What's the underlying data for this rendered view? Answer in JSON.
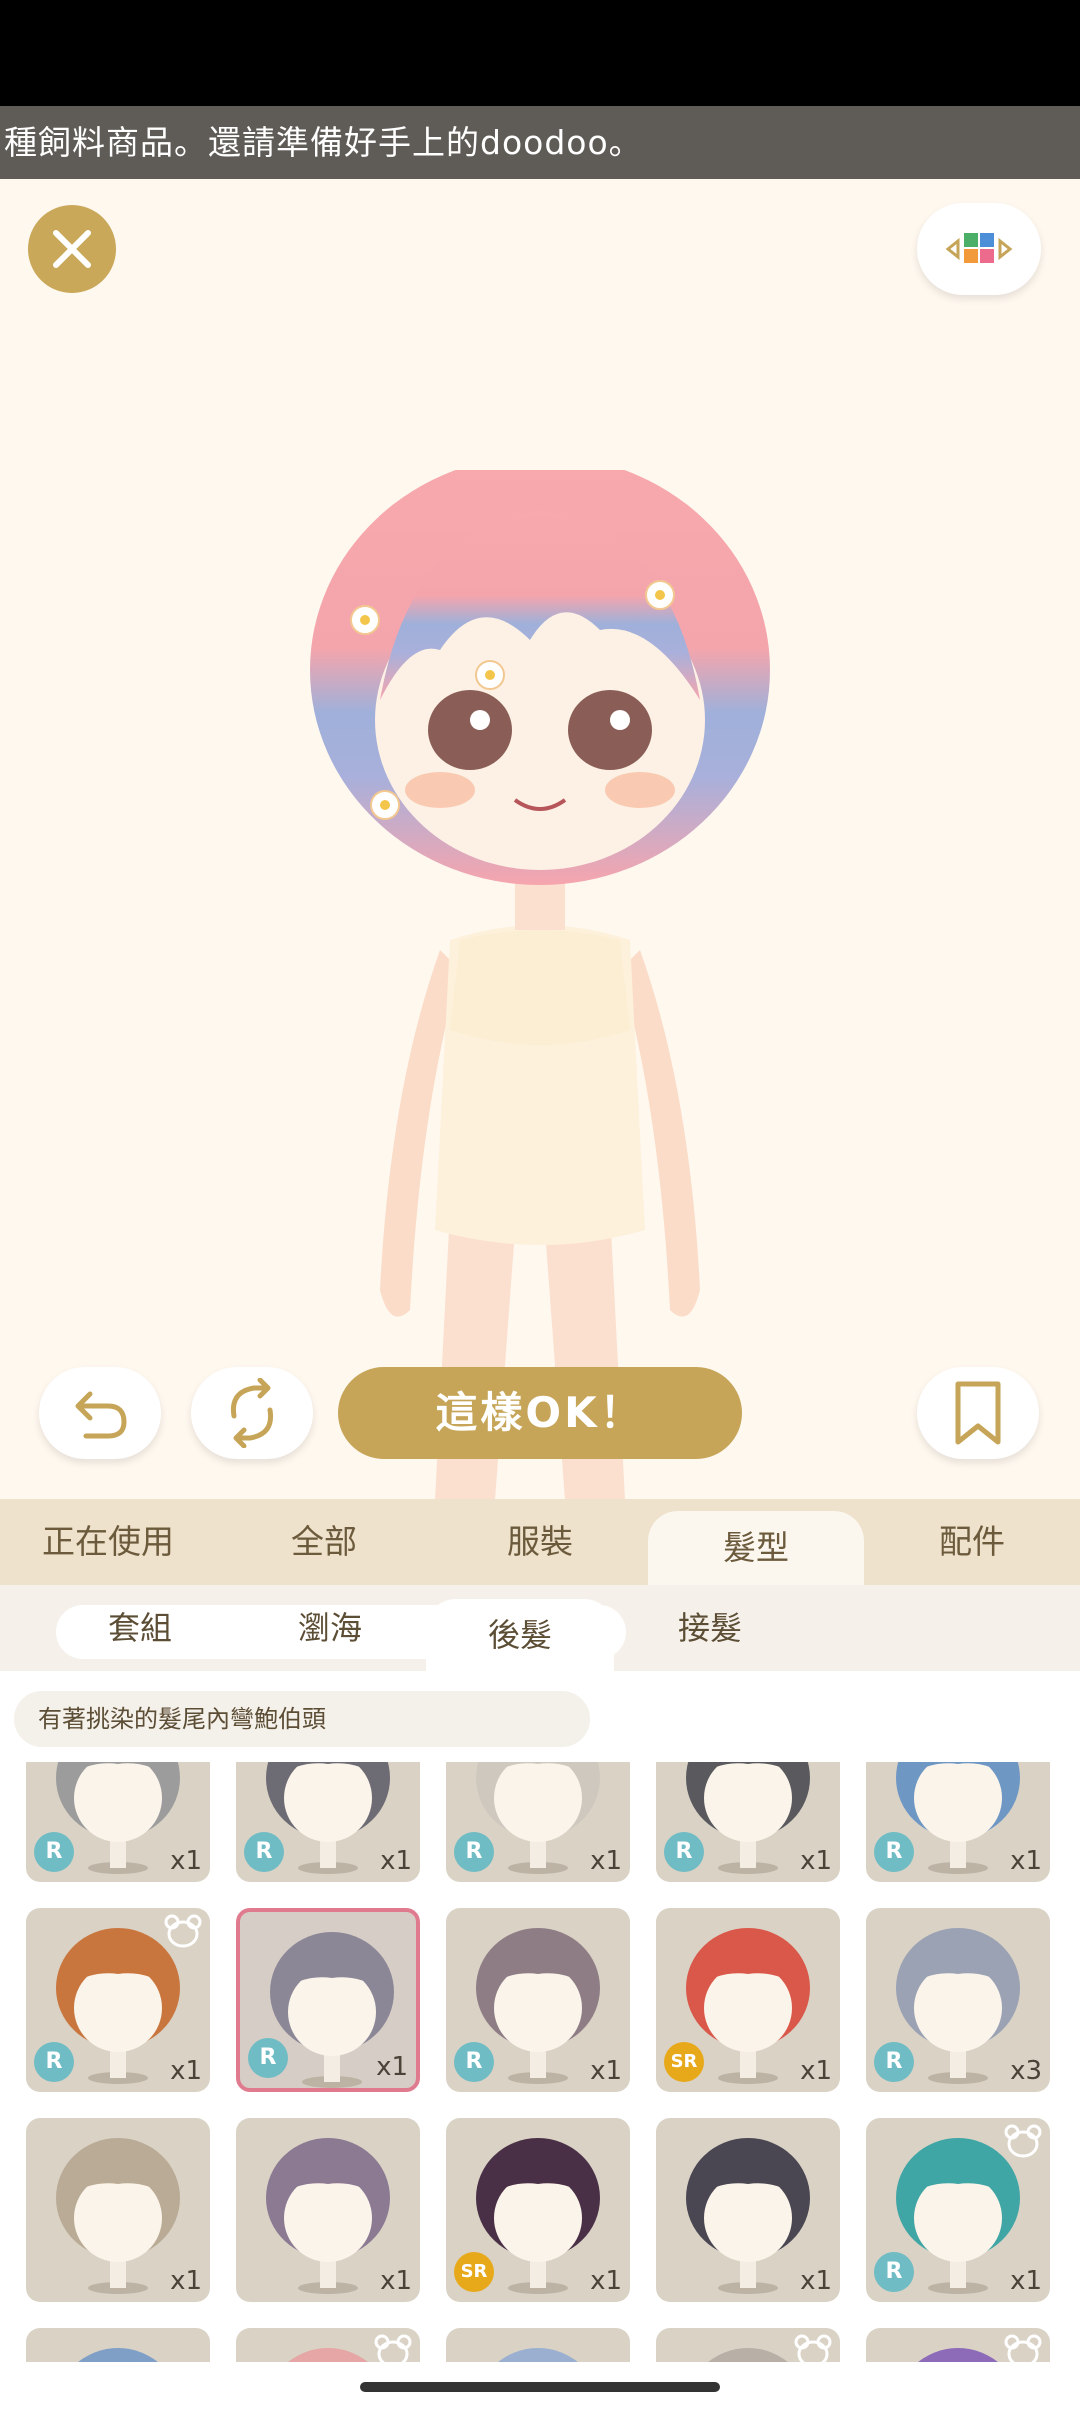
{
  "marquee": {
    "text": "種飼料商品。還請準備好手上的doodoo。"
  },
  "actions": {
    "ok_label": "這樣OK！"
  },
  "tabs": [
    {
      "label": "正在使用"
    },
    {
      "label": "全部"
    },
    {
      "label": "服裝"
    },
    {
      "label": "髮型",
      "active": true
    },
    {
      "label": "配件"
    }
  ],
  "subtabs": [
    {
      "label": "套組"
    },
    {
      "label": "瀏海"
    },
    {
      "label": "後髮",
      "active": true
    },
    {
      "label": "接髮"
    }
  ],
  "item_description": "有著挑染的髮尾內彎鮑伯頭",
  "items": [
    {
      "rarity": "R",
      "count": "x1",
      "hair_color": "#9c9c9c"
    },
    {
      "rarity": "R",
      "count": "x1",
      "hair_color": "#6d6b73"
    },
    {
      "rarity": "R",
      "count": "x1",
      "hair_color": "#cfc8bf"
    },
    {
      "rarity": "R",
      "count": "x1",
      "hair_color": "#5a5a5e"
    },
    {
      "rarity": "R",
      "count": "x1",
      "hair_color": "#6f97c4"
    },
    {
      "rarity": "R",
      "count": "x1",
      "hair_color": "#c9763e",
      "bear": true
    },
    {
      "rarity": "R",
      "count": "x1",
      "hair_color": "#8b8797",
      "selected": true
    },
    {
      "rarity": "R",
      "count": "x1",
      "hair_color": "#8f7d85"
    },
    {
      "rarity": "SR",
      "count": "x1",
      "hair_color": "#d9584a"
    },
    {
      "rarity": "R",
      "count": "x3",
      "hair_color": "#9aa2b4"
    },
    {
      "rarity": "",
      "count": "x1",
      "hair_color": "#b9ab95"
    },
    {
      "rarity": "",
      "count": "x1",
      "hair_color": "#8c7a93"
    },
    {
      "rarity": "SR",
      "count": "x1",
      "hair_color": "#4a3046"
    },
    {
      "rarity": "",
      "count": "x1",
      "hair_color": "#4a4652"
    },
    {
      "rarity": "R",
      "count": "x1",
      "hair_color": "#3fa5a5",
      "bear": true
    },
    {
      "rarity": "",
      "count": "",
      "hair_color": "#7f9fc7"
    },
    {
      "rarity": "",
      "count": "",
      "hair_color": "#e7a6a6",
      "bear": true
    },
    {
      "rarity": "",
      "count": "",
      "hair_color": "#9bb0d0"
    },
    {
      "rarity": "",
      "count": "",
      "hair_color": "#b8b0a6",
      "bear": true
    },
    {
      "rarity": "",
      "count": "",
      "hair_color": "#8e6bb8",
      "bear": true
    }
  ],
  "colors": {
    "accent_gold": "#c6a558",
    "tab_bg": "#efe2cc",
    "selected_border": "#e07a8f"
  },
  "icons": [
    "close-icon",
    "color-grid-icon",
    "undo-icon",
    "refresh-icon",
    "bookmark-icon",
    "bear-icon"
  ]
}
